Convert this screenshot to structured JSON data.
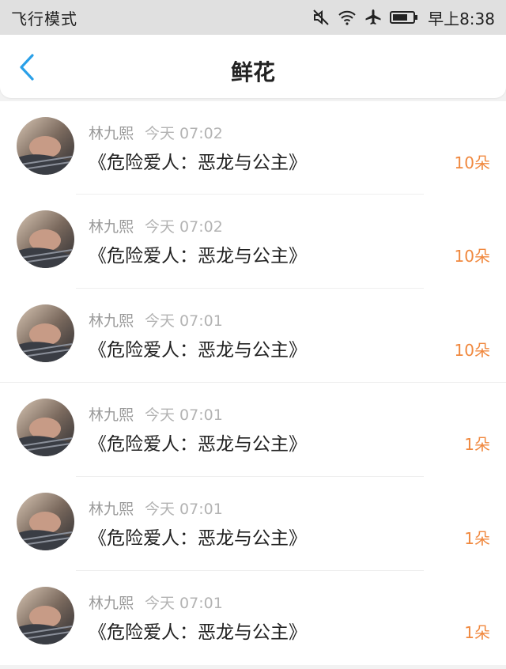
{
  "status_bar": {
    "mode": "飞行模式",
    "time": "早上8:38",
    "icons": [
      "mute-icon",
      "wifi-icon",
      "airplane-icon",
      "battery-icon"
    ]
  },
  "nav": {
    "title": "鲜花",
    "back_icon": "chevron-left-icon",
    "accent": "#2aa0e8"
  },
  "colors": {
    "amount": "#f0883e",
    "name": "#9a9a9a"
  },
  "records": [
    {
      "name": "林九熙",
      "time": "今天 07:02",
      "book": "《危险爱人：恶龙与公主》",
      "amount": "10朵"
    },
    {
      "name": "林九熙",
      "time": "今天 07:02",
      "book": "《危险爱人：恶龙与公主》",
      "amount": "10朵"
    },
    {
      "name": "林九熙",
      "time": "今天 07:01",
      "book": "《危险爱人：恶龙与公主》",
      "amount": "10朵"
    },
    {
      "name": "林九熙",
      "time": "今天 07:01",
      "book": "《危险爱人：恶龙与公主》",
      "amount": "1朵"
    },
    {
      "name": "林九熙",
      "time": "今天 07:01",
      "book": "《危险爱人：恶龙与公主》",
      "amount": "1朵"
    },
    {
      "name": "林九熙",
      "time": "今天 07:01",
      "book": "《危险爱人：恶龙与公主》",
      "amount": "1朵"
    }
  ]
}
